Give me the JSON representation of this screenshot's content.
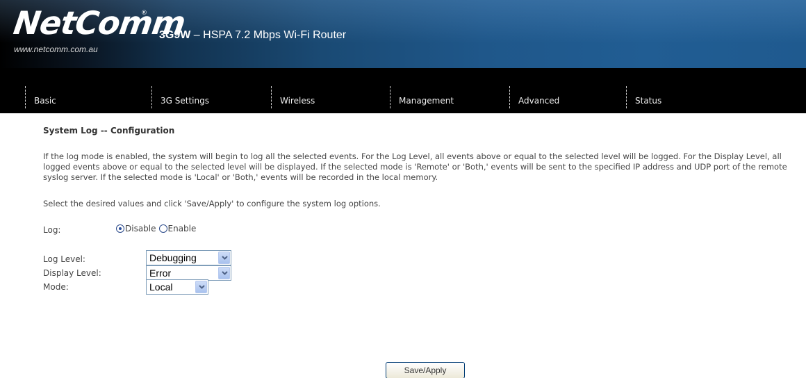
{
  "brand": {
    "logo_text": "NetComm",
    "logo_reg": "®",
    "url": "www.netcomm.com.au",
    "model": "3G9W",
    "product_suffix": "– HSPA 7.2 Mbps Wi-Fi Router"
  },
  "nav": {
    "items": [
      {
        "label": "Basic"
      },
      {
        "label": "3G Settings"
      },
      {
        "label": "Wireless"
      },
      {
        "label": "Management"
      },
      {
        "label": "Advanced"
      },
      {
        "label": "Status"
      }
    ]
  },
  "page": {
    "title": "System Log -- Configuration",
    "description": "If the log mode is enabled, the system will begin to log all the selected events. For the Log Level, all events above or equal to the selected level will be logged. For the Display Level, all logged events above or equal to the selected level will be displayed. If the selected mode is 'Remote' or 'Both,' events will be sent to the specified IP address and UDP port of the remote syslog server. If the selected mode is 'Local' or 'Both,' events will be recorded in the local memory.",
    "instructions": "Select the desired values and click 'Save/Apply' to configure the system log options."
  },
  "form": {
    "log": {
      "label": "Log:",
      "options": [
        "Disable",
        "Enable"
      ],
      "selected": "Disable"
    },
    "log_level": {
      "label": "Log Level:",
      "value": "Debugging"
    },
    "display_level": {
      "label": "Display Level:",
      "value": "Error"
    },
    "mode": {
      "label": "Mode:",
      "value": "Local"
    }
  },
  "buttons": {
    "save_apply": "Save/Apply"
  },
  "colors": {
    "banner_blue": "#1f578a",
    "nav_background": "#000000"
  }
}
